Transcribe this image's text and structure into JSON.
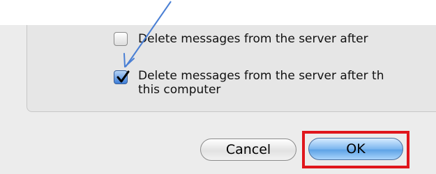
{
  "options": [
    {
      "label": "Delete messages from the server after",
      "checked": false
    },
    {
      "label_line1": "Delete messages from the server after th",
      "label_line2": "this computer",
      "checked": true
    }
  ],
  "buttons": {
    "cancel": "Cancel",
    "ok": "OK"
  },
  "annotations": {
    "highlight_color": "#e0161c",
    "arrow_color": "#4a7fd4"
  }
}
